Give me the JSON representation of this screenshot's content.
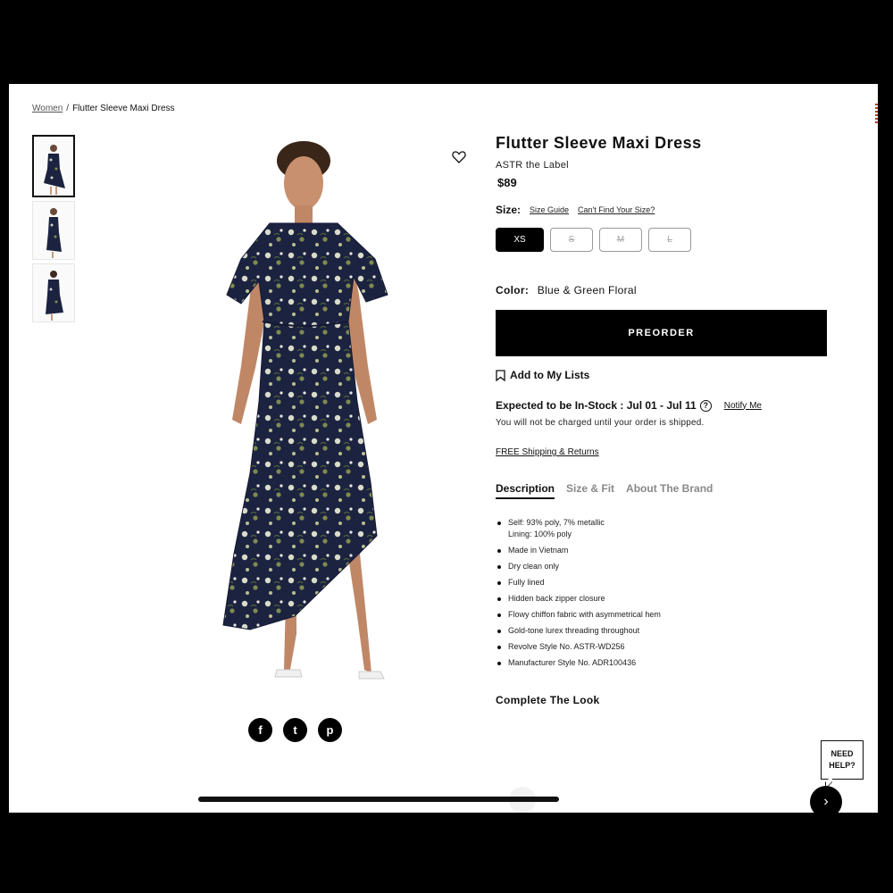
{
  "breadcrumb": {
    "parent": "Women",
    "separator": "/",
    "current": "Flutter Sleeve Maxi Dress"
  },
  "product": {
    "title": "Flutter Sleeve Maxi Dress",
    "brand": "ASTR the Label",
    "price": "$89",
    "size_label": "Size:",
    "size_guide": "Size Guide",
    "cant_find_size": "Can't Find Your Size?",
    "sizes": [
      {
        "label": "XS",
        "selected": true
      },
      {
        "label": "S",
        "available": false
      },
      {
        "label": "M",
        "available": false
      },
      {
        "label": "L",
        "available": false
      }
    ],
    "color_label": "Color:",
    "color_value": "Blue & Green Floral",
    "preorder_label": "PREORDER",
    "add_to_lists": "Add to My Lists",
    "stock_text": "Expected to be In-Stock : Jul 01 - Jul 11",
    "help_mark": "?",
    "notify_me": "Notify Me",
    "charge_note": "You will not be charged until your order is shipped.",
    "shipping_link": "FREE Shipping & Returns"
  },
  "tabs": [
    {
      "label": "Description",
      "active": true
    },
    {
      "label": "Size & Fit"
    },
    {
      "label": "About The Brand"
    }
  ],
  "details": [
    [
      "Self: 93% poly, 7% metallic",
      "Lining: 100% poly"
    ],
    [
      "Made in Vietnam"
    ],
    [
      "Dry clean only"
    ],
    [
      "Fully lined"
    ],
    [
      "Hidden back zipper closure"
    ],
    [
      "Flowy chiffon fabric with asymmetrical hem"
    ],
    [
      "Gold-tone lurex threading throughout"
    ],
    [
      "Revolve Style No. ASTR-WD256"
    ],
    [
      "Manufacturer Style No. ADR100436"
    ]
  ],
  "complete_the_look": "Complete The Look",
  "share": {
    "facebook": "f",
    "twitter": "t",
    "pinterest": "p"
  },
  "need_help": "NEED HELP?",
  "chat_icon": "›",
  "colors": {
    "dress_navy": "#1c2340",
    "floral_green": "#7f8a4e",
    "accent_red": "#c0392b"
  }
}
